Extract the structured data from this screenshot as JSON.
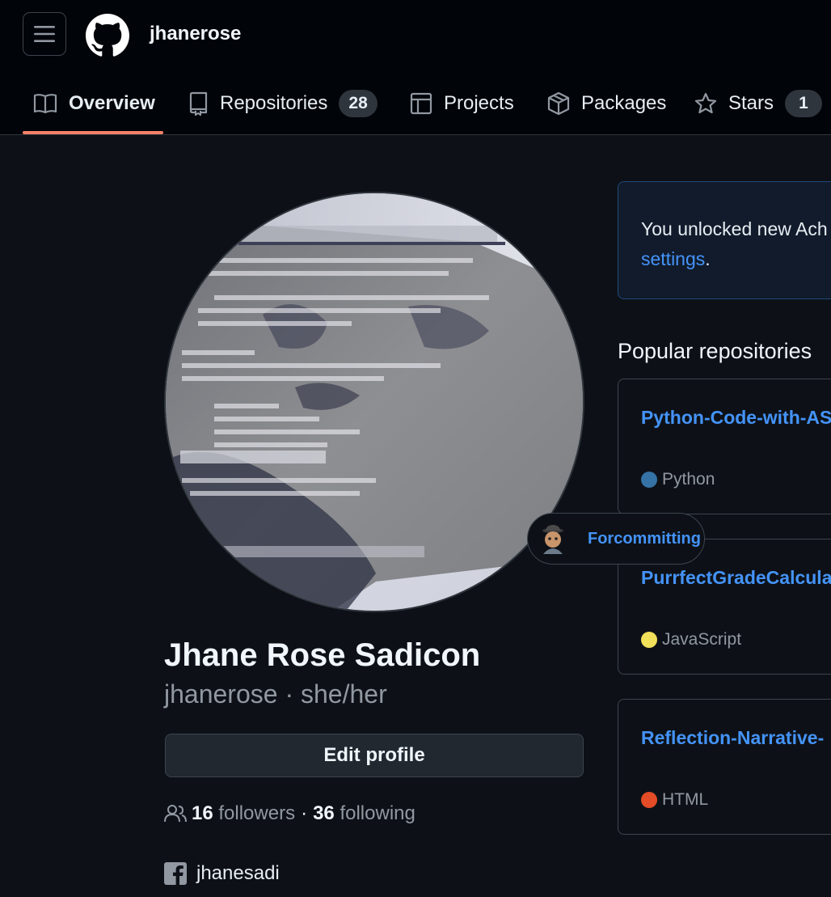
{
  "header": {
    "username": "jhanerose",
    "icons": {
      "menu": "hamburger-menu-icon",
      "logo": "github-logo-icon"
    }
  },
  "tabs": [
    {
      "label": "Overview",
      "icon": "book-icon",
      "active": true
    },
    {
      "label": "Repositories",
      "icon": "repo-icon",
      "count": "28"
    },
    {
      "label": "Projects",
      "icon": "table-icon"
    },
    {
      "label": "Packages",
      "icon": "package-icon"
    },
    {
      "label": "Stars",
      "icon": "star-icon",
      "count": "1"
    }
  ],
  "status": {
    "text": "Forcommitting",
    "icon": "detective-emoji-icon"
  },
  "profile": {
    "full_name": "Jhane Rose Sadicon",
    "login": "jhanerose",
    "separator": "·",
    "pronouns": "she/her",
    "edit_button": "Edit profile",
    "followers_count": "16",
    "followers_label": "followers",
    "following_count": "36",
    "following_label": "following",
    "dot": "·",
    "social": {
      "icon": "facebook-icon",
      "handle": "jhanesadi"
    }
  },
  "achievement": {
    "text": "You unlocked new Ach",
    "link": "settings",
    "suffix": "."
  },
  "popular": {
    "title": "Popular repositories",
    "repos": [
      {
        "name": "Python-Code-with-AS",
        "language": "Python",
        "color": "#3572A5"
      },
      {
        "name": "PurrfectGradeCalcula",
        "language": "JavaScript",
        "color": "#f1e05a"
      },
      {
        "name": "Reflection-Narrative-",
        "language": "HTML",
        "color": "#e34c26"
      }
    ]
  },
  "colors": {
    "background": "#0d1117",
    "header": "#010409",
    "accent": "#f78166",
    "link": "#4493f8"
  }
}
